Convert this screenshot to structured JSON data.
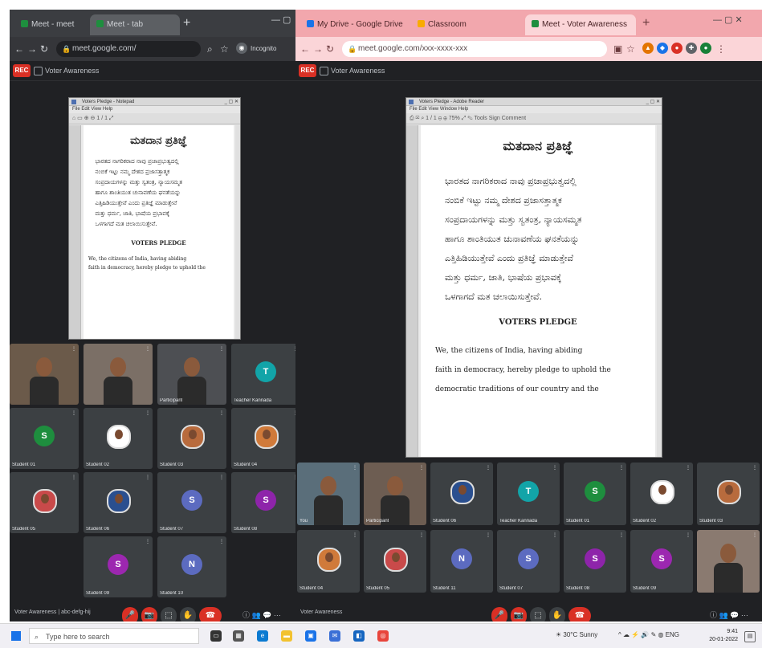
{
  "left_window": {
    "tabs": [
      {
        "label": "Meet - meet",
        "active": false
      },
      {
        "label": "Meet - tab",
        "active": true
      }
    ],
    "url": "meet.google.com/",
    "profile_label": "Incognito",
    "meeting_name": "Voter Awareness",
    "presentation": {
      "title_bar": "Voters Pledge - Notepad",
      "menu": "File  Edit  View  Help",
      "toolbar": "⌂ ▭ ⊕ ⊖   1 / 1   ⤢",
      "heading": "ಮತದಾನ ಪ್ರತಿಜ್ಞೆ",
      "lines": [
        "ಭಾರತದ ನಾಗರಿಕರಾದ ನಾವು ಪ್ರಜಾಪ್ರಭುತ್ವದಲ್ಲಿ",
        "ನಂಬಿಕೆ ಇಟ್ಟು ನಮ್ಮ ದೇಶದ ಪ್ರಜಾಸತ್ತಾತ್ಮಕ",
        "ಸಂಪ್ರದಾಯಗಳನ್ನು ಮತ್ತು ಸ್ವತಂತ್ರ, ನ್ಯಾಯಸಮ್ಮತ",
        "ಹಾಗೂ ಶಾಂತಿಯುತ ಚುನಾವಣೆಯ ಘನತೆಯನ್ನು",
        "ಎತ್ತಿಹಿಡಿಯುತ್ತೇವೆ ಎಂದು ಪ್ರತಿಜ್ಞೆ ಮಾಡುತ್ತೇವೆ",
        "ಮತ್ತು ಧರ್ಮ, ಜಾತಿ, ಭಾಷೆಯ ಪ್ರಭಾವಕ್ಕೆ",
        "ಒಳಗಾಗದೆ ಮತ ಚಲಾಯಿಸುತ್ತೇವೆ."
      ],
      "section": "VOTERS PLEDGE",
      "english_lines": [
        "We, the citizens of India, having abiding",
        "faith in democracy, hereby pledge to uphold the"
      ]
    },
    "tiles": [
      {
        "name": "",
        "initial": "",
        "color": "#6b5a4a",
        "type": "video"
      },
      {
        "name": "",
        "initial": "",
        "color": "#7b6f66",
        "type": "video"
      },
      {
        "name": "Participant",
        "initial": "",
        "color": "#4d4f53",
        "type": "video"
      },
      {
        "name": "Teacher Kannada",
        "initial": "T",
        "color": "#12a4a8",
        "type": "avatar"
      },
      {
        "name": "Student 01",
        "initial": "S",
        "color": "#1e8e3e",
        "type": "avatar"
      },
      {
        "name": "Student 02",
        "initial": "",
        "color": "#ffffff",
        "type": "photo"
      },
      {
        "name": "Student 03",
        "initial": "",
        "color": "#b86b3d",
        "type": "photo"
      },
      {
        "name": "Student 04",
        "initial": "",
        "color": "#d07a3a",
        "type": "photo"
      },
      {
        "name": "Student 05",
        "initial": "",
        "color": "#c94a4a",
        "type": "photo"
      },
      {
        "name": "Student 06",
        "initial": "",
        "color": "#2a4f8f",
        "type": "photo"
      },
      {
        "name": "Student 07",
        "initial": "S",
        "color": "#5c6bc0",
        "type": "avatar"
      },
      {
        "name": "Student 08",
        "initial": "S",
        "color": "#8e24aa",
        "type": "avatar"
      },
      {
        "name": "Student 09",
        "initial": "S",
        "color": "#9c27b0",
        "type": "avatar"
      },
      {
        "name": "Student 10",
        "initial": "N",
        "color": "#5c6bc0",
        "type": "avatar"
      }
    ],
    "meeting_code": "Voter Awareness | abc-defg-hij",
    "controls": [
      "🎤",
      "📷",
      "⬚",
      "✋",
      "☎"
    ]
  },
  "right_window": {
    "tabs": [
      {
        "label": "My Drive - Google Drive",
        "active": false
      },
      {
        "label": "Classroom",
        "active": false
      },
      {
        "label": "Meet - Voter Awareness",
        "active": true
      }
    ],
    "url": "meet.google.com/xxx-xxxx-xxx",
    "meeting_name": "Voter Awareness",
    "presentation": {
      "title_bar": "Voters Pledge - Adobe Reader",
      "menu": "File  Edit  View  Window  Help",
      "toolbar": "⎙ ✉ ⌕  1 / 1  ⊖ ⊕ 75%  ⤢  ✎ Tools  Sign  Comment",
      "heading": "ಮತದಾನ ಪ್ರತಿಜ್ಞೆ",
      "lines": [
        "ಭಾರತದ ನಾಗರಿಕರಾದ ನಾವು ಪ್ರಜಾಪ್ರಭುತ್ವದಲ್ಲಿ",
        "ನಂಬಿಕೆ ಇಟ್ಟು ನಮ್ಮ ದೇಶದ ಪ್ರಜಾಸತ್ತಾತ್ಮಕ",
        "ಸಂಪ್ರದಾಯಗಳನ್ನು ಮತ್ತು ಸ್ವತಂತ್ರ, ನ್ಯಾಯಸಮ್ಮತ",
        "ಹಾಗೂ ಶಾಂತಿಯುತ ಚುನಾವಣೆಯ ಘನತೆಯನ್ನು",
        "ಎತ್ತಿಹಿಡಿಯುತ್ತೇವೆ ಎಂದು ಪ್ರತಿಜ್ಞೆ ಮಾಡುತ್ತೇವೆ",
        "ಮತ್ತು ಧರ್ಮ, ಜಾತಿ, ಭಾಷೆಯ ಪ್ರಭಾವಕ್ಕೆ",
        "ಒಳಗಾಗದೆ ಮತ ಚಲಾಯಿಸುತ್ತೇವೆ."
      ],
      "section": "VOTERS PLEDGE",
      "english_lines": [
        "We, the citizens of India, having abiding",
        "faith in democracy, hereby pledge to uphold the",
        "democratic traditions of our country and the"
      ]
    },
    "tiles": [
      {
        "name": "You",
        "initial": "",
        "color": "#5a6e7a",
        "type": "video"
      },
      {
        "name": "Participant",
        "initial": "",
        "color": "#6d5d52",
        "type": "video"
      },
      {
        "name": "Student 06",
        "initial": "",
        "color": "#2a4f8f",
        "type": "photo"
      },
      {
        "name": "Teacher Kannada",
        "initial": "T",
        "color": "#12a4a8",
        "type": "avatar"
      },
      {
        "name": "Student 01",
        "initial": "S",
        "color": "#1e8e3e",
        "type": "avatar"
      },
      {
        "name": "Student 02",
        "initial": "",
        "color": "#ffffff",
        "type": "photo"
      },
      {
        "name": "Student 03",
        "initial": "",
        "color": "#b86b3d",
        "type": "photo"
      },
      {
        "name": "Student 04",
        "initial": "",
        "color": "#d07a3a",
        "type": "photo"
      },
      {
        "name": "Student 05",
        "initial": "",
        "color": "#c94a4a",
        "type": "photo"
      },
      {
        "name": "Student 11",
        "initial": "N",
        "color": "#5c6bc0",
        "type": "avatar"
      },
      {
        "name": "Student 07",
        "initial": "S",
        "color": "#5c6bc0",
        "type": "avatar"
      },
      {
        "name": "Student 08",
        "initial": "S",
        "color": "#8e24aa",
        "type": "avatar"
      },
      {
        "name": "Student 09",
        "initial": "S",
        "color": "#9c27b0",
        "type": "avatar"
      },
      {
        "name": "",
        "initial": "",
        "color": "#8a7a70",
        "type": "video"
      }
    ],
    "meeting_code": "Voter Awareness",
    "controls": [
      "🎤",
      "📷",
      "⬚",
      "✋",
      "☎"
    ]
  },
  "taskbar": {
    "search_placeholder": "Type here to search",
    "weather": "30°C Sunny",
    "clock_time": "9:41",
    "clock_date": "20-01-2022",
    "notif": "▤"
  }
}
